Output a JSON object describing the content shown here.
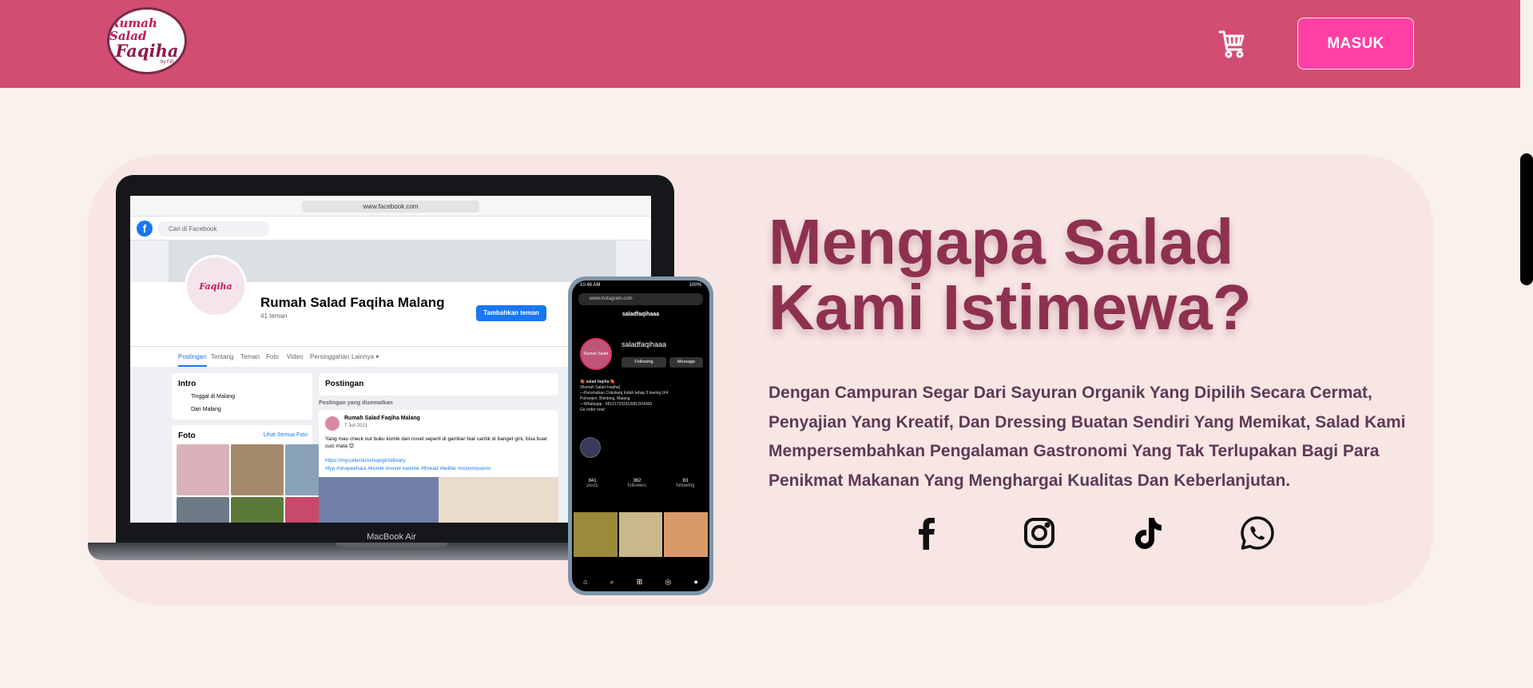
{
  "header": {
    "logo_line1": "Rumah Salad",
    "logo_line2": "Faqiha",
    "logo_line3": "by Fifi",
    "login_label": "MASUK",
    "bg_color": "#d14d72",
    "button_color": "#ff3fa4"
  },
  "hero": {
    "title": "Mengapa Salad Kami Istimewa?",
    "description": "Dengan Campuran Segar Dari Sayuran Organik Yang Dipilih Secara Cermat, Penyajian Yang Kreatif, Dan Dressing Buatan Sendiri Yang Memikat, Salad Kami Mempersembahkan Pengalaman Gastronomi Yang Tak Terlupakan Bagi Para Penikmat Makanan Yang Menghargai Kualitas Dan Keberlanjutan.",
    "title_color": "#8e3150",
    "card_color": "#f8e6e4"
  },
  "laptop": {
    "label": "MacBook Air",
    "url": "www.facebook.com",
    "search_placeholder": "Cari di Facebook",
    "page_name": "Rumah Salad Faqiha Malang",
    "friends": "41 teman",
    "add_friend": "Tambahkan teman",
    "tabs": [
      "Postingan",
      "Tentang",
      "Teman",
      "Foto",
      "Video",
      "Persinggahan",
      "Lainnya ▾"
    ],
    "intro_title": "Intro",
    "intro_lines": [
      "Tinggal di Malang",
      "Dari Malang"
    ],
    "photos_title": "Foto",
    "photos_link": "Lihat Semua Foto",
    "posts_title": "Postingan",
    "pinned": "Postingan yang disematkan",
    "post_author": "Rumah Salad Faqiha Malang",
    "post_date": "7 Juli 2021 · ",
    "post_text": "Yang mau check out buku komik dan novel seperti di gambar biar cantik di banget gini, bisa buat cuci mata 😊",
    "post_link": "https://mycollectionshop/girlslibrary",
    "post_tags": "#fyp #shopeehaul #komik #novel #anime #thread #twitter #commissions"
  },
  "phone": {
    "time": "10:46 AM",
    "battery": "100%",
    "url": "www.instagram.com",
    "title": "saladfaqihaaa",
    "username": "saladfaqihaaa",
    "following": "Following",
    "message": "Message",
    "bio": [
      "🍓 salad faqiha 🍓",
      "(Rumah Salad Faqiha)",
      "—Perumahan Cokolang Indah tahap 3 kaving U/4",
      "Polowijen, Blimbing, Malang",
      "—Whatsapp : 08121723331/081/324309",
      "Go order now!"
    ],
    "stats": [
      {
        "n": "841",
        "l": "posts"
      },
      {
        "n": "362",
        "l": "followers"
      },
      {
        "n": "83",
        "l": "following"
      }
    ]
  },
  "socials": {
    "items": [
      "facebook",
      "instagram",
      "tiktok",
      "whatsapp"
    ],
    "color": "#111111"
  },
  "icons": {
    "cart": "cart-icon",
    "facebook": "facebook-icon",
    "instagram": "instagram-icon",
    "tiktok": "tiktok-icon",
    "whatsapp": "whatsapp-icon"
  }
}
